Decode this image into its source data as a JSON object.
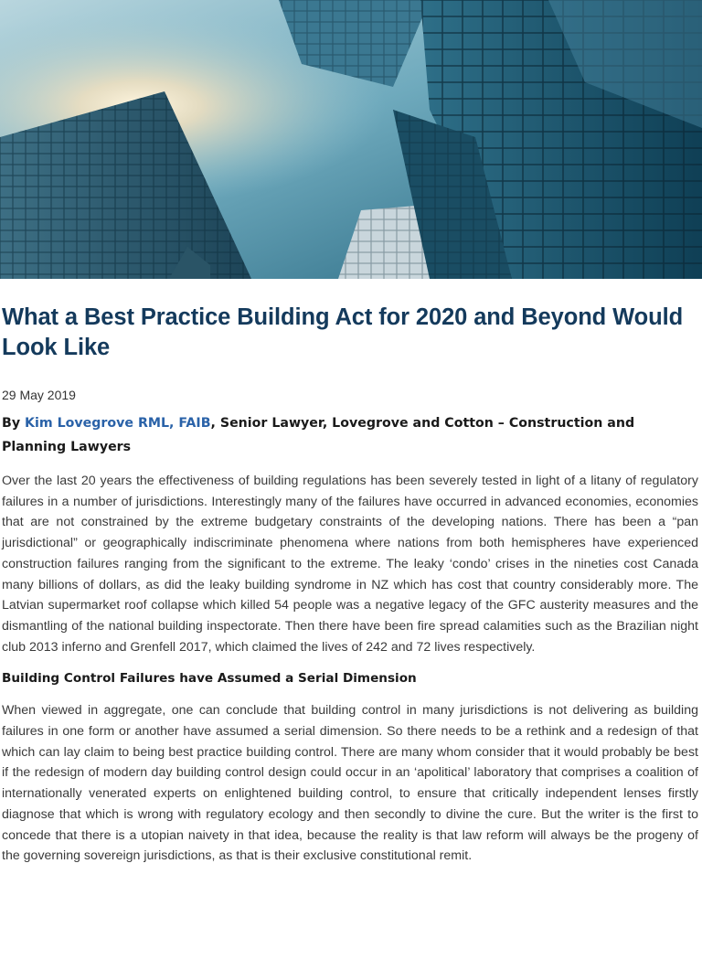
{
  "article": {
    "title": "What a Best Practice Building Act for 2020 and Beyond Would Look Like",
    "date": "29 May 2019",
    "byline": {
      "prefix": "By ",
      "author": "Kim Lovegrove RML, FAIB",
      "suffix": ", Senior Lawyer, Lovegrove and Cotton – Construction and Planning Lawyers"
    },
    "paragraph_1": "Over the last 20 years the effectiveness of building regulations has been severely tested in light of a litany of regulatory failures in a number of jurisdictions. Interestingly many of the failures have occurred in advanced economies, economies that are not constrained by the extreme budgetary constraints of the developing nations. There has been a “pan jurisdictional” or geographically indiscriminate phenomena where nations from both hemispheres have experienced construction failures ranging from the significant to the extreme. The leaky ‘condo’ crises in the nineties cost Canada many billions of dollars, as did the leaky building syndrome in NZ which has cost that country considerably more. The Latvian supermarket roof collapse which killed 54 people was a negative legacy of the GFC austerity measures and the dismantling of the national building inspectorate.  Then there have been fire spread calamities such as the Brazilian night club 2013 inferno and Grenfell 2017, which claimed the lives of 242 and 72 lives respectively.",
    "subheading_1": "Building Control Failures have Assumed a Serial Dimension",
    "paragraph_2": "When viewed in aggregate, one can conclude that building control in many jurisdictions is not delivering as building failures in one form or another have assumed a serial dimension. So there needs to be a rethink and a redesign of that which can lay claim to being best practice building control.  There are many whom consider that it would probably be best if the redesign of modern day building control design could occur in an ‘apolitical’ laboratory that comprises a coalition of internationally venerated experts on enlightened building control, to ensure that critically independent lenses firstly diagnose that which is wrong with regulatory ecology and then secondly to divine the cure. But the writer is the first to concede that there is a utopian naivety in that idea, because the reality is that law reform will always be the progeny of the governing sovereign jurisdictions, as that is their exclusive constitutional remit."
  },
  "colors": {
    "title": "#143a5c",
    "author_link": "#2a62a8",
    "body_text": "#3a3a3a"
  }
}
